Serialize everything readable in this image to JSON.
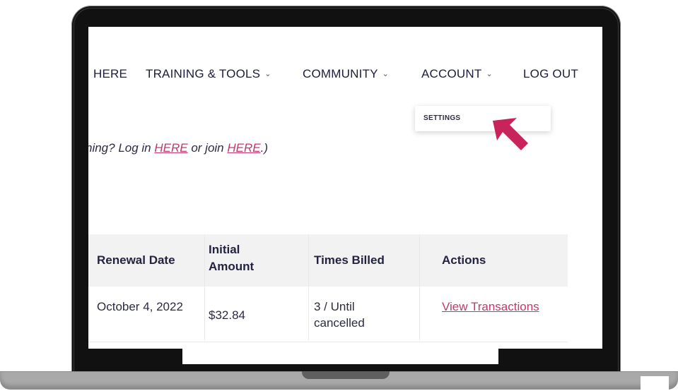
{
  "nav": {
    "items": [
      {
        "label": "HERE",
        "has_chevron": false
      },
      {
        "label": "TRAINING & TOOLS",
        "has_chevron": true
      },
      {
        "label": "COMMUNITY",
        "has_chevron": true
      },
      {
        "label": "ACCOUNT",
        "has_chevron": true
      },
      {
        "label": "LOG OUT",
        "has_chevron": false
      }
    ],
    "chevron_glyph": "⌄"
  },
  "dropdown": {
    "items": [
      "SETTINGS"
    ]
  },
  "login_notice": {
    "prefix": "hing? Log in ",
    "login_link": "HERE",
    "middle": " or join ",
    "join_link": "HERE",
    "suffix": ".)"
  },
  "table": {
    "headers": [
      "Renewal Date",
      "Initial Amount",
      "Times Billed",
      "Actions"
    ],
    "rows": [
      {
        "renewal_date": "October 4, 2022",
        "initial_amount": "$32.84",
        "times_billed": "3 / Until cancelled",
        "action": "View Transactions"
      }
    ]
  },
  "colors": {
    "link": "#c03a6b",
    "arrow": "#c8235a",
    "text": "#1c1c3c",
    "header_bg": "#f2f2f2"
  },
  "icons": {
    "pointer": "arrow-pointer-icon"
  }
}
